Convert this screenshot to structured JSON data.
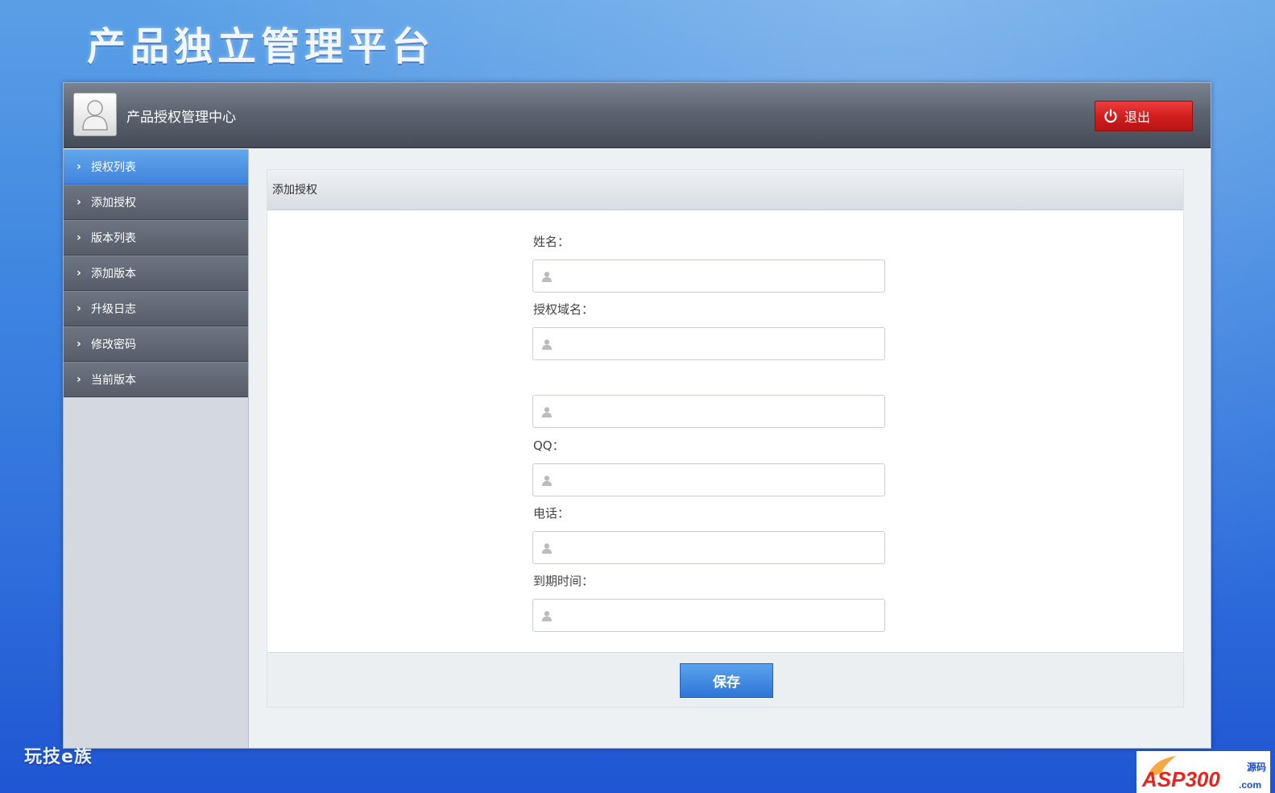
{
  "platform_title": "产品独立管理平台",
  "header": {
    "center_title": "产品授权管理中心",
    "logout_label": "退出"
  },
  "sidebar": {
    "items": [
      {
        "label": "授权列表",
        "active": true
      },
      {
        "label": "添加授权",
        "active": false
      },
      {
        "label": "版本列表",
        "active": false
      },
      {
        "label": "添加版本",
        "active": false
      },
      {
        "label": "升级日志",
        "active": false
      },
      {
        "label": "修改密码",
        "active": false
      },
      {
        "label": "当前版本",
        "active": false
      }
    ]
  },
  "panel": {
    "title": "添加授权",
    "fields": [
      {
        "label": "姓名：",
        "value": ""
      },
      {
        "label": "授权域名：",
        "value": ""
      },
      {
        "label": "",
        "value": ""
      },
      {
        "label": "QQ：",
        "value": ""
      },
      {
        "label": "电话：",
        "value": ""
      },
      {
        "label": "到期时间：",
        "value": ""
      }
    ],
    "save_label": "保存"
  },
  "footer": {
    "brand": "玩技e族",
    "watermark": "ASP300",
    "watermark_suffix": "源码",
    "watermark_domain": ".com"
  },
  "colors": {
    "accent": "#3f84dc",
    "logout": "#cf1d1d",
    "header": "#5d6471"
  }
}
